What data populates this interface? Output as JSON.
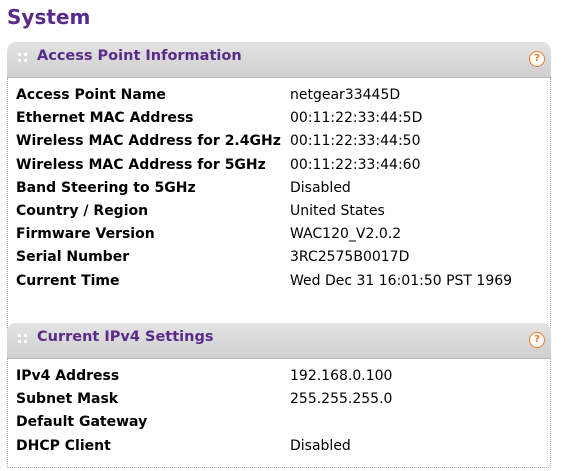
{
  "page": {
    "title": "System"
  },
  "access_point_panel": {
    "title": "Access Point Information",
    "help_icon": "?",
    "rows": [
      {
        "label": "Access Point Name",
        "value": "netgear33445D"
      },
      {
        "label": "Ethernet MAC Address",
        "value": "00:11:22:33:44:5D"
      },
      {
        "label": "Wireless MAC Address for 2.4GHz",
        "value": "00:11:22:33:44:50"
      },
      {
        "label": "Wireless MAC Address for 5GHz",
        "value": "00:11:22:33:44:60"
      },
      {
        "label": "Band Steering to 5GHz",
        "value": "Disabled"
      },
      {
        "label": "Country / Region",
        "value": "United States"
      },
      {
        "label": "Firmware Version",
        "value": "WAC120_V2.0.2"
      },
      {
        "label": "Serial Number",
        "value": "3RC2575B0017D"
      },
      {
        "label": "Current Time",
        "value": "Wed Dec 31 16:01:50 PST 1969"
      }
    ]
  },
  "ipv4_panel": {
    "title": "Current IPv4 Settings",
    "help_icon": "?",
    "rows": [
      {
        "label": "IPv4 Address",
        "value": "192.168.0.100"
      },
      {
        "label": "Subnet Mask",
        "value": "255.255.255.0"
      },
      {
        "label": "Default Gateway",
        "value": ""
      },
      {
        "label": "DHCP Client",
        "value": "Disabled"
      }
    ]
  },
  "colors": {
    "title_purple": "#5a2a8a",
    "help_orange": "#f07820",
    "header_gray": "#d8d8d8"
  }
}
